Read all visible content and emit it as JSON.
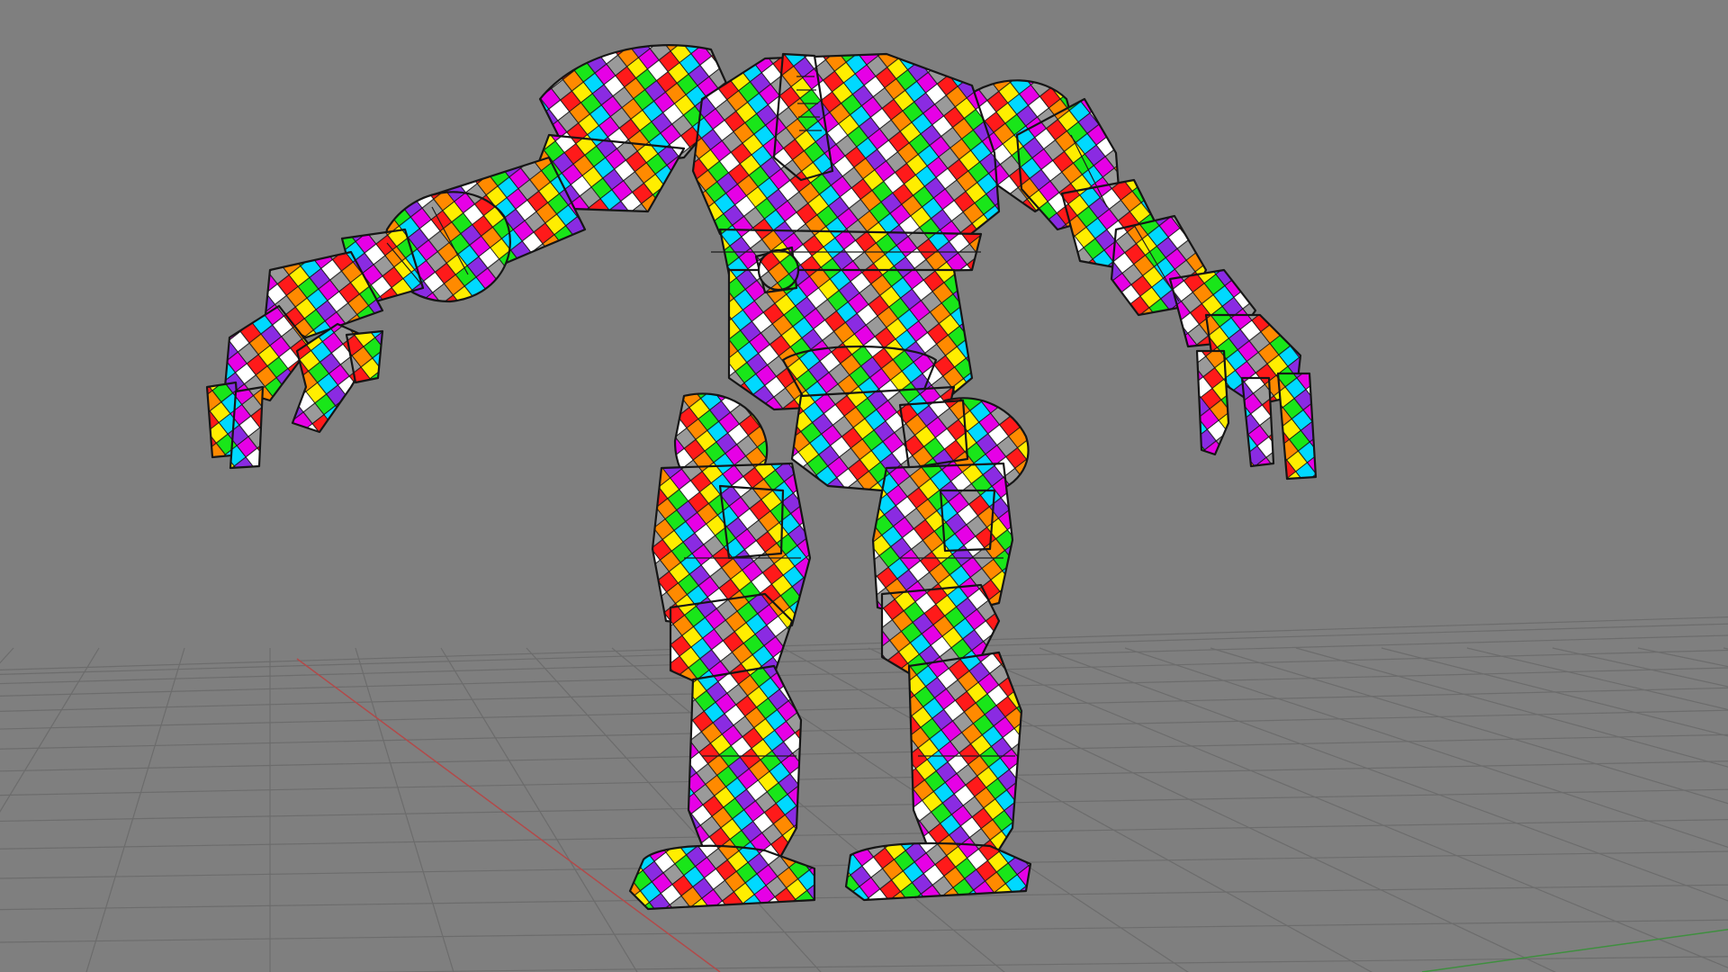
{
  "app": {
    "view": "3d-viewport",
    "render_mode": "uv-checker-texture-with-wireframe"
  },
  "viewport": {
    "background_color": "#7f7f7f",
    "grid": {
      "visible": true,
      "line_color": "#6c6c6c",
      "x_axis_color": "#b24a4a",
      "z_axis_color": "#3f8f3f"
    },
    "model": {
      "subject": "humanoid-robot-mech",
      "pose": "a-pose",
      "texture_colors": [
        "#ff1a1a",
        "#ff8a00",
        "#ffee00",
        "#19e619",
        "#00d9ff",
        "#8a2be2",
        "#e600e6",
        "#ffffff",
        "#9a9a9a"
      ],
      "outline_color": "#151515"
    }
  }
}
